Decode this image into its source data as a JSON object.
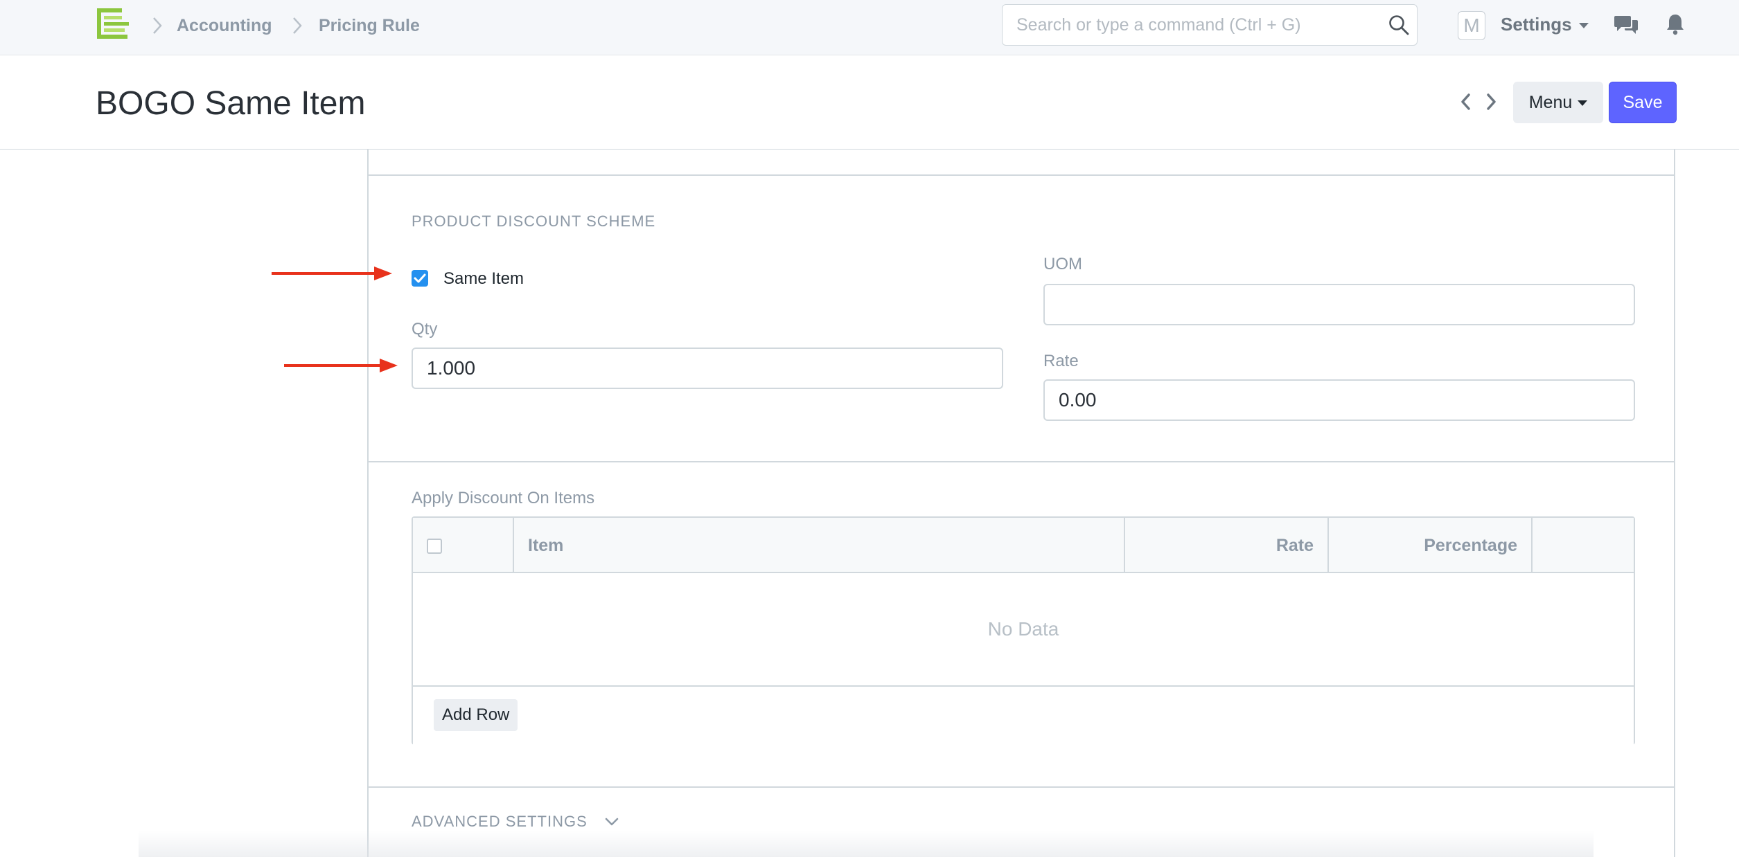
{
  "navbar": {
    "breadcrumbs": [
      "Accounting",
      "Pricing Rule"
    ],
    "search_placeholder": "Search or type a command (Ctrl + G)",
    "avatar_letter": "M",
    "settings_label": "Settings"
  },
  "page": {
    "title": "BOGO Same Item",
    "menu_label": "Menu",
    "save_label": "Save",
    "accent_color": "#5e64ff"
  },
  "product_discount": {
    "section_title": "PRODUCT DISCOUNT SCHEME",
    "same_item_label": "Same Item",
    "same_item_checked": true,
    "qty_label": "Qty",
    "qty_value": "1.000",
    "uom_label": "UOM",
    "uom_value": "",
    "rate_label": "Rate",
    "rate_value": "0.00"
  },
  "apply_discount": {
    "label": "Apply Discount On Items",
    "columns": [
      "Item",
      "Rate",
      "Percentage"
    ],
    "empty_text": "No Data",
    "add_row_label": "Add Row"
  },
  "advanced": {
    "section_title": "ADVANCED SETTINGS"
  },
  "annotations": {
    "arrow_color": "#e8321c"
  }
}
